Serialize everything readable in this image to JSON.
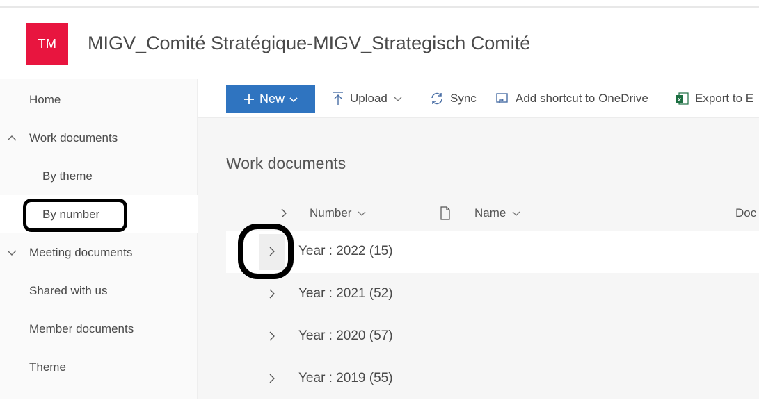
{
  "header": {
    "logo_text": "TM",
    "site_title": "MIGV_Comité Stratégique-MIGV_Strategisch Comité",
    "logo_color": "#e8153f"
  },
  "nav": {
    "items": [
      {
        "label": "Home"
      },
      {
        "label": "Work documents",
        "state": "expanded"
      },
      {
        "label": "By theme"
      },
      {
        "label": "By number",
        "state": "selected"
      },
      {
        "label": "Meeting documents",
        "state": "collapsed"
      },
      {
        "label": "Shared with us"
      },
      {
        "label": "Member documents"
      },
      {
        "label": "Theme"
      }
    ]
  },
  "toolbar": {
    "new_label": "New",
    "upload_label": "Upload",
    "sync_label": "Sync",
    "shortcut_label": "Add shortcut to OneDrive",
    "export_label": "Export to E",
    "accent_color": "#2f74c0",
    "excel_color": "#1d6f42"
  },
  "library": {
    "title": "Work documents",
    "columns": [
      {
        "label": "Number"
      },
      {
        "label": "Name"
      },
      {
        "label": "Doc"
      }
    ],
    "groups": [
      {
        "label": "Year : 2022 (15)"
      },
      {
        "label": "Year : 2021 (52)"
      },
      {
        "label": "Year : 2020 (57)"
      },
      {
        "label": "Year : 2019 (55)"
      }
    ]
  }
}
